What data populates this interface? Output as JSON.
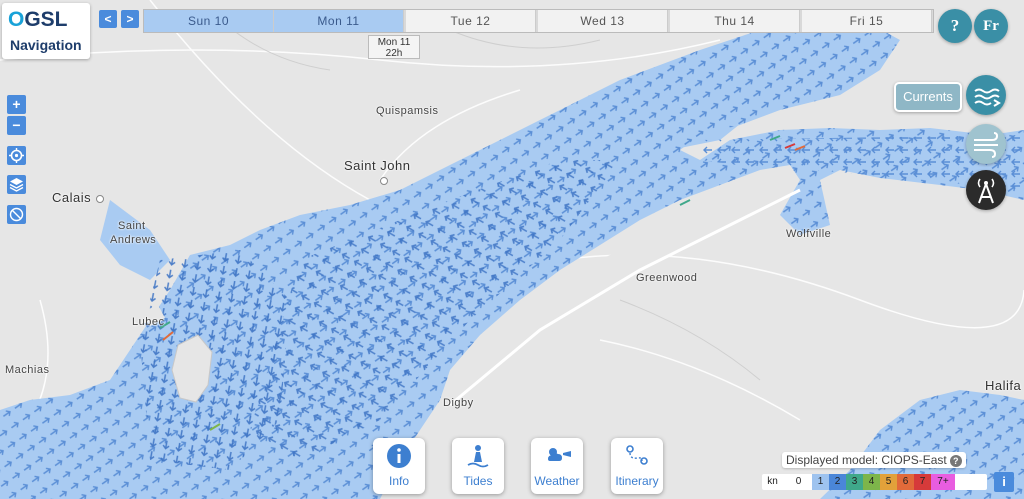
{
  "app": {
    "logo_text_o": "O",
    "logo_text_gsl": "GSL",
    "logo_subtitle": "Navigation"
  },
  "nav": {
    "prev_icon": "chevron-left-icon",
    "next_icon": "chevron-right-icon",
    "prev_label": "<",
    "next_label": ">"
  },
  "timeline": {
    "days": [
      {
        "label": "Sun 10",
        "state": "past"
      },
      {
        "label": "Mon 11",
        "state": "past"
      },
      {
        "label": "Tue 12",
        "state": "future"
      },
      {
        "label": "Wed 13",
        "state": "future"
      },
      {
        "label": "Thu 14",
        "state": "future"
      },
      {
        "label": "Fri 15",
        "state": "future"
      }
    ],
    "cursor_day": "Mon 11",
    "cursor_time": "22h"
  },
  "top_right": {
    "help_label": "?",
    "language_label": "Fr"
  },
  "zoom": {
    "in_label": "+",
    "out_label": "−"
  },
  "layers": {
    "currents_label": "Currents"
  },
  "places": {
    "quispamsis": "Quispamsis",
    "saint_john": "Saint John",
    "calais": "Calais",
    "saint_andrews_1": "Saint",
    "saint_andrews_2": "Andrews",
    "lubec": "Lubec",
    "machias": "Machias",
    "greenwood": "Greenwood",
    "wolfville": "Wolfville",
    "digby": "Digby",
    "halifax": "Halifa"
  },
  "bottom_bar": {
    "info_label": "Info",
    "tides_label": "Tides",
    "weather_label": "Weather",
    "itinerary_label": "Itinerary"
  },
  "model": {
    "text": "Displayed model: CIOPS-East",
    "help": "?"
  },
  "legend": {
    "unit": "kn",
    "levels": [
      {
        "label": "0",
        "color": "#ffffff"
      },
      {
        "label": "1",
        "color": "#9ec3ef"
      },
      {
        "label": "2",
        "color": "#4a86d8"
      },
      {
        "label": "3",
        "color": "#3fa88a"
      },
      {
        "label": "4",
        "color": "#7db54a"
      },
      {
        "label": "5",
        "color": "#e2a13a"
      },
      {
        "label": "6",
        "color": "#e16a3a"
      },
      {
        "label": "7",
        "color": "#d63a3a"
      },
      {
        "label": "7+",
        "color": "#e85de0"
      }
    ]
  },
  "info_corner_label": "i",
  "colors": {
    "water": "#a9cbf2",
    "land": "#e6e6e6",
    "accent": "#4a8bdc",
    "teal": "#3a8fa6"
  }
}
